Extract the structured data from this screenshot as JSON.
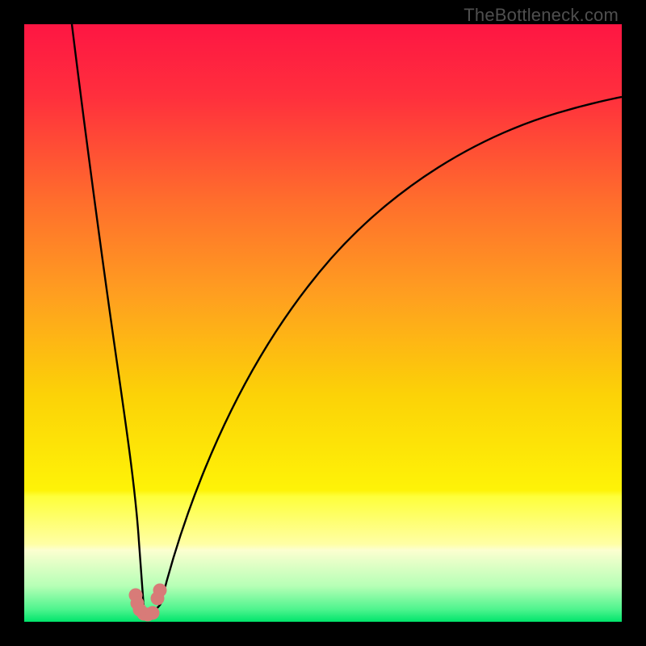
{
  "watermark": {
    "text": "TheBottleneck.com"
  },
  "chart_data": {
    "type": "line",
    "title": "",
    "xlabel": "",
    "ylabel": "",
    "xlim": [
      0,
      100
    ],
    "ylim": [
      0,
      100
    ],
    "grid": false,
    "legend": false,
    "background_gradient": {
      "top": "#fe1643",
      "upper_mid": "#ff8f25",
      "mid": "#fcd807",
      "lower_mid": "#feff3a",
      "band": "#ffffa5",
      "bottom": "#00e46b"
    },
    "series": [
      {
        "name": "left-branch",
        "color": "#000000",
        "x": [
          8,
          10,
          12,
          14,
          16,
          17,
          18,
          19,
          19.7
        ],
        "y": [
          100,
          82,
          65,
          48,
          32,
          23,
          15,
          8,
          2
        ]
      },
      {
        "name": "right-branch",
        "color": "#000000",
        "x": [
          23,
          25,
          28,
          32,
          37,
          44,
          52,
          62,
          74,
          88,
          100
        ],
        "y": [
          2,
          8,
          18,
          30,
          42,
          54,
          64,
          72,
          79,
          84,
          87
        ]
      }
    ],
    "markers": {
      "name": "vertex-markers",
      "color": "#d87b78",
      "points": [
        {
          "x": 18.6,
          "y": 4.4
        },
        {
          "x": 18.8,
          "y": 3.1
        },
        {
          "x": 19.3,
          "y": 2.0
        },
        {
          "x": 19.9,
          "y": 1.4
        },
        {
          "x": 20.6,
          "y": 1.2
        },
        {
          "x": 21.4,
          "y": 1.5
        },
        {
          "x": 22.3,
          "y": 3.9
        },
        {
          "x": 22.7,
          "y": 5.3
        }
      ]
    }
  }
}
